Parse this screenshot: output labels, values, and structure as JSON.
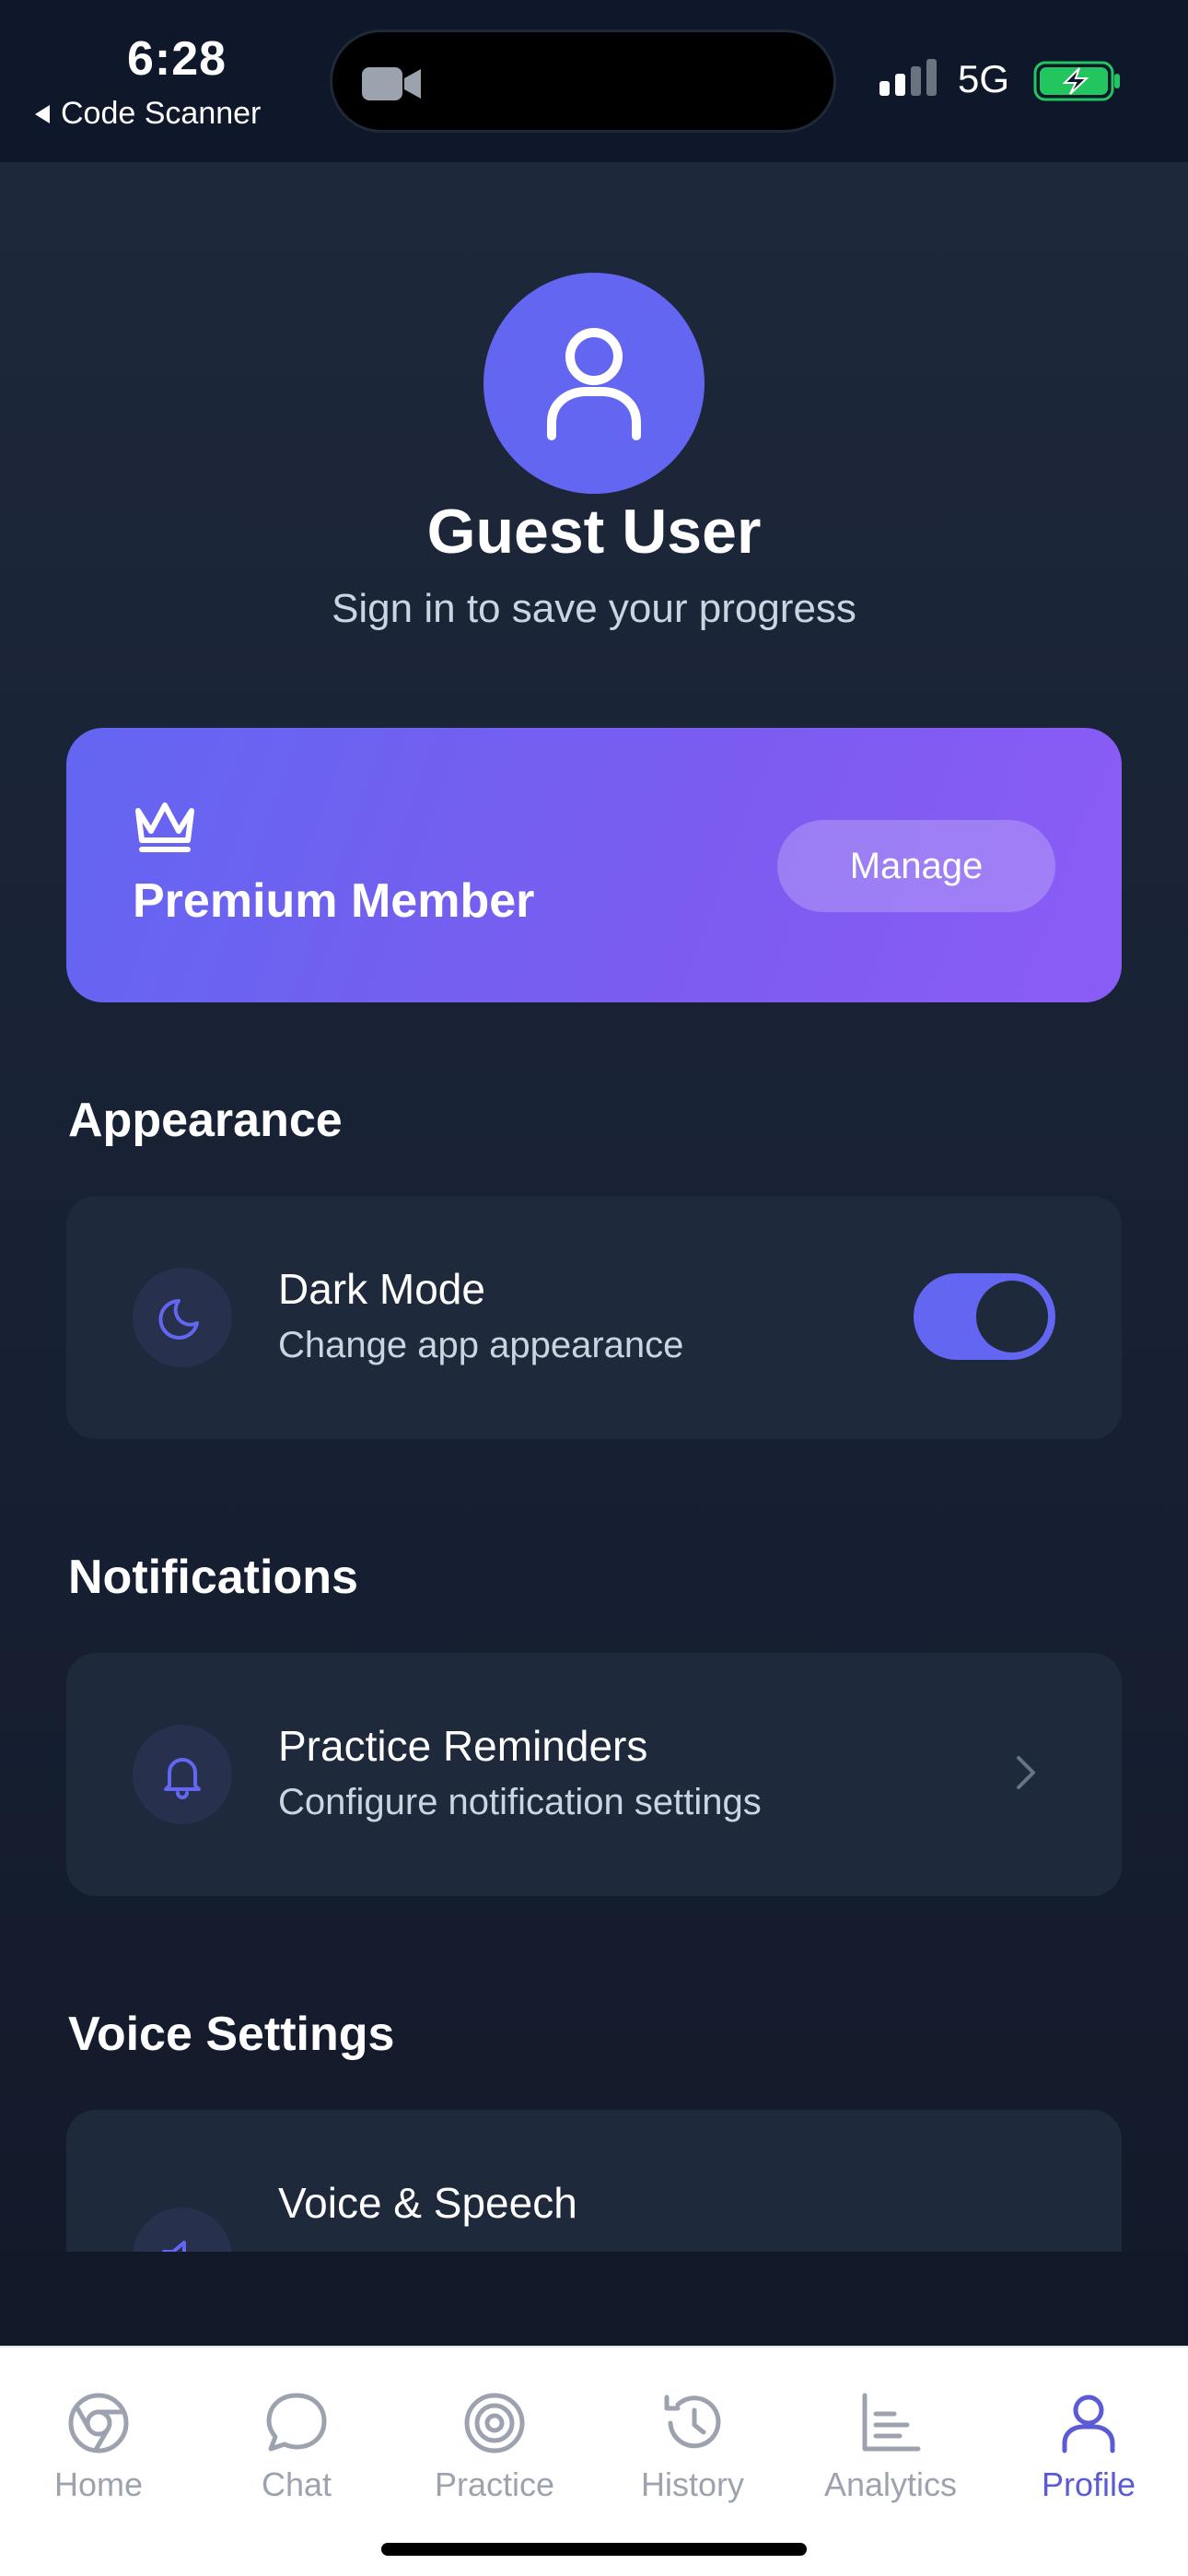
{
  "status_bar": {
    "time": "6:28",
    "back_app": "Code Scanner",
    "network": "5G"
  },
  "profile": {
    "name": "Guest User",
    "subtitle": "Sign in to save your progress"
  },
  "premium": {
    "title": "Premium Member",
    "button": "Manage",
    "gradient_start": "#6366f1",
    "gradient_end": "#8b5cf6"
  },
  "sections": {
    "appearance": {
      "title": "Appearance",
      "item_title": "Dark Mode",
      "item_desc": "Change app appearance",
      "toggle_on": true
    },
    "notifications": {
      "title": "Notifications",
      "item_title": "Practice Reminders",
      "item_desc": "Configure notification settings"
    },
    "voice": {
      "title": "Voice Settings",
      "item_title": "Voice & Speech"
    }
  },
  "tabs": [
    {
      "label": "Home",
      "icon": "chrome-icon"
    },
    {
      "label": "Chat",
      "icon": "chat-bubble-icon"
    },
    {
      "label": "Practice",
      "icon": "target-icon"
    },
    {
      "label": "History",
      "icon": "history-icon"
    },
    {
      "label": "Analytics",
      "icon": "chart-icon"
    },
    {
      "label": "Profile",
      "icon": "user-icon",
      "active": true
    }
  ],
  "colors": {
    "accent": "#6366f1",
    "background": "#1e293b",
    "card": "#1e293b"
  }
}
